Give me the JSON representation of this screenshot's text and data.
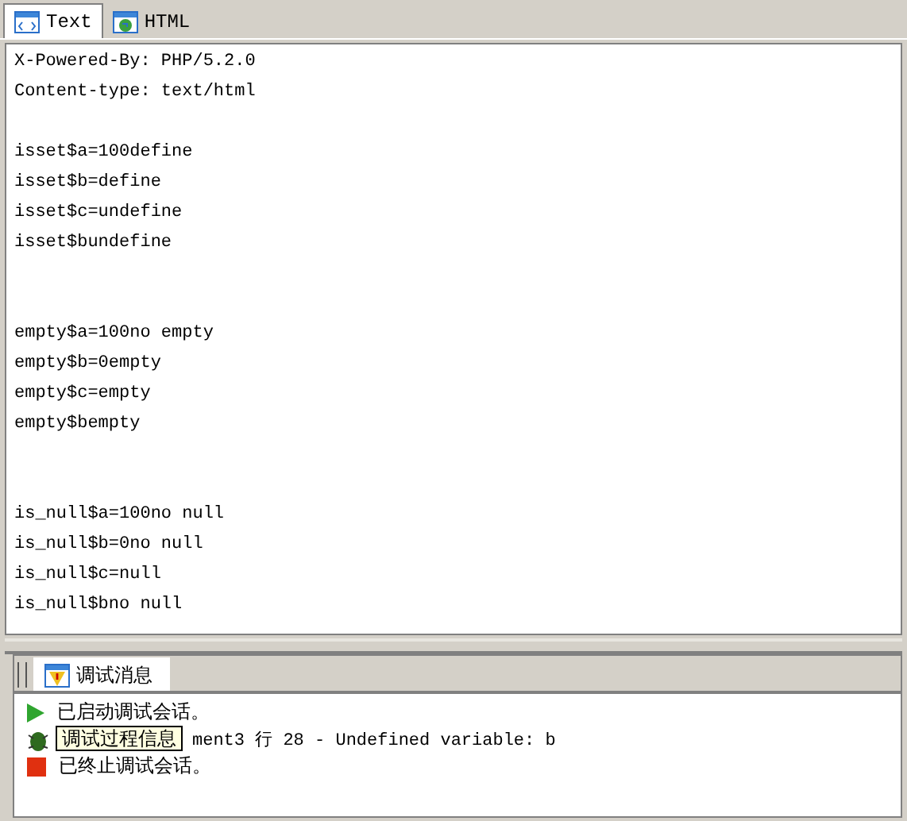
{
  "tabs": [
    {
      "label": "Text",
      "selected": true
    },
    {
      "label": "HTML",
      "selected": false
    }
  ],
  "output_blocks": [
    [
      "X-Powered-By: PHP/5.2.0",
      "Content-type: text/html"
    ],
    [
      "isset$a=100define",
      "isset$b=define",
      "isset$c=undefine",
      "isset$bundefine"
    ],
    [
      "empty$a=100no empty",
      "empty$b=0empty",
      "empty$c=empty",
      "empty$bempty"
    ],
    [
      "is_null$a=100no null",
      "is_null$b=0no null",
      "is_null$c=null",
      "is_null$bno null"
    ]
  ],
  "debug_panel": {
    "tab": {
      "label": "调试消息",
      "selected": true
    },
    "messages": [
      {
        "kind": "start",
        "text": "已启动调试会话。"
      },
      {
        "kind": "warning",
        "text": "ment3 行 28 - Undefined variable: b"
      },
      {
        "kind": "stop",
        "text": "已终止调试会话。"
      }
    ],
    "tooltip": "调试过程信息"
  }
}
